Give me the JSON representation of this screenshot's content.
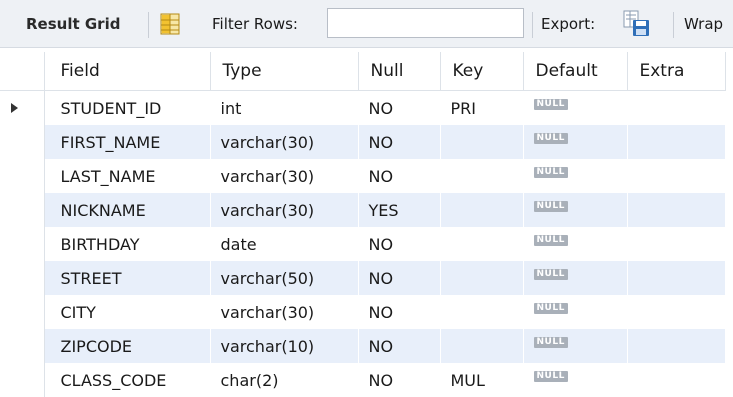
{
  "toolbar": {
    "result_grid_label": "Result Grid",
    "filter_rows_label": "Filter Rows:",
    "filter_rows_value": "",
    "export_label": "Export:",
    "wrap_label": "Wrap",
    "grid_icon": "grid-layout-icon",
    "export_icon": "export-save-icon"
  },
  "columns": [
    "Field",
    "Type",
    "Null",
    "Key",
    "Default",
    "Extra"
  ],
  "rows": [
    {
      "field": "STUDENT_ID",
      "type": "int",
      "null": "NO",
      "key": "PRI",
      "default": "NULL",
      "extra": "",
      "selected": true
    },
    {
      "field": "FIRST_NAME",
      "type": "varchar(30)",
      "null": "NO",
      "key": "",
      "default": "NULL",
      "extra": ""
    },
    {
      "field": "LAST_NAME",
      "type": "varchar(30)",
      "null": "NO",
      "key": "",
      "default": "NULL",
      "extra": ""
    },
    {
      "field": "NICKNAME",
      "type": "varchar(30)",
      "null": "YES",
      "key": "",
      "default": "NULL",
      "extra": ""
    },
    {
      "field": "BIRTHDAY",
      "type": "date",
      "null": "NO",
      "key": "",
      "default": "NULL",
      "extra": ""
    },
    {
      "field": "STREET",
      "type": "varchar(50)",
      "null": "NO",
      "key": "",
      "default": "NULL",
      "extra": ""
    },
    {
      "field": "CITY",
      "type": "varchar(30)",
      "null": "NO",
      "key": "",
      "default": "NULL",
      "extra": ""
    },
    {
      "field": "ZIPCODE",
      "type": "varchar(10)",
      "null": "NO",
      "key": "",
      "default": "NULL",
      "extra": ""
    },
    {
      "field": "CLASS_CODE",
      "type": "char(2)",
      "null": "NO",
      "key": "MUL",
      "default": "NULL",
      "extra": ""
    }
  ],
  "colors": {
    "toolbar_bg": "#eef1f5",
    "stripe_bg": "#e8effa",
    "null_badge_bg": "#a9b0b9",
    "grid_icon_yellow": "#f2c230",
    "export_icon_blue": "#2f6fb8"
  }
}
